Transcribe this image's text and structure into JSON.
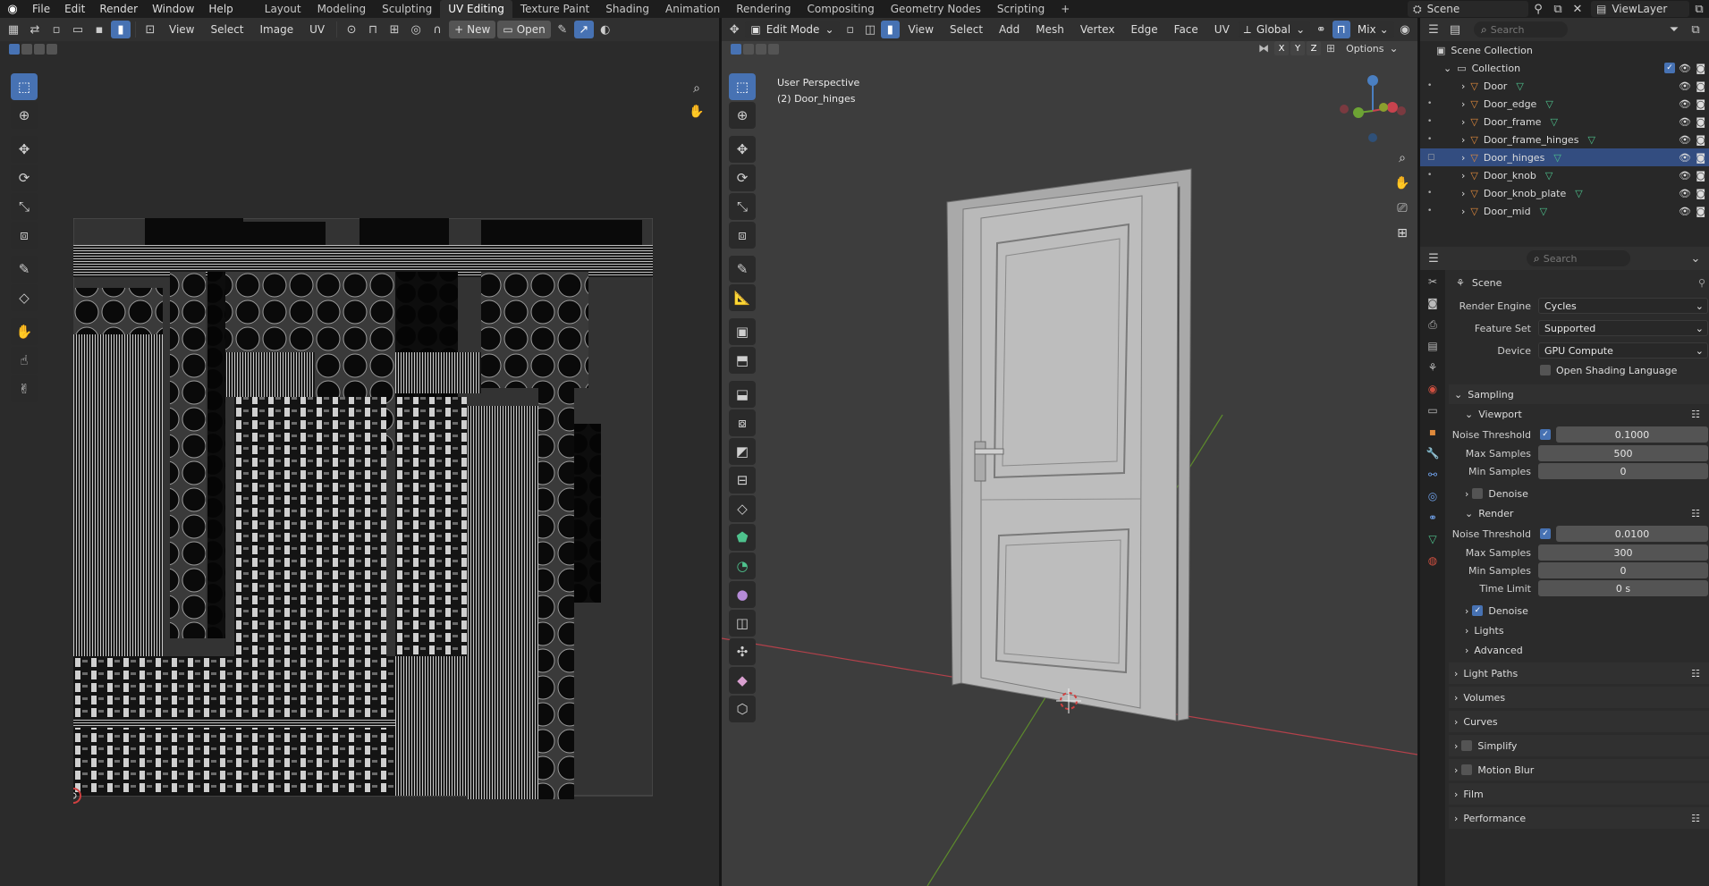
{
  "menu": {
    "items": [
      "File",
      "Edit",
      "Render",
      "Window",
      "Help"
    ],
    "workspaces": [
      "Layout",
      "Modeling",
      "Sculpting",
      "UV Editing",
      "Texture Paint",
      "Shading",
      "Animation",
      "Rendering",
      "Compositing",
      "Geometry Nodes",
      "Scripting"
    ],
    "active_workspace": "UV Editing",
    "add_tab": "+",
    "scene_name": "Scene",
    "view_layer": "ViewLayer"
  },
  "uv_editor": {
    "menus": [
      "View",
      "Select",
      "Image",
      "UV"
    ],
    "new_label": "New",
    "open_label": "Open"
  },
  "viewport": {
    "mode": "Edit Mode",
    "menus": [
      "View",
      "Select",
      "Add",
      "Mesh",
      "Vertex",
      "Edge",
      "Face",
      "UV"
    ],
    "orientation": "Global",
    "snap_label": "Mix",
    "options_label": "Options",
    "axes": [
      "X",
      "Y",
      "Z"
    ],
    "overlay_title": "User Perspective",
    "overlay_object": "(2) Door_hinges"
  },
  "outliner": {
    "search_placeholder": "Search",
    "scene_collection": "Scene Collection",
    "collection": "Collection",
    "objects": [
      "Door",
      "Door_edge",
      "Door_frame",
      "Door_frame_hinges",
      "Door_hinges",
      "Door_knob",
      "Door_knob_plate",
      "Door_mid"
    ],
    "selected": "Door_hinges"
  },
  "properties": {
    "search_placeholder": "Search",
    "context": "Scene",
    "render_engine_label": "Render Engine",
    "render_engine": "Cycles",
    "feature_set_label": "Feature Set",
    "feature_set": "Supported",
    "device_label": "Device",
    "device": "GPU Compute",
    "osl_label": "Open Shading Language",
    "sampling": "Sampling",
    "viewport": {
      "label": "Viewport",
      "noise_threshold_label": "Noise Threshold",
      "noise_threshold": "0.1000",
      "max_samples_label": "Max Samples",
      "max_samples": "500",
      "min_samples_label": "Min Samples",
      "min_samples": "0",
      "denoise_label": "Denoise"
    },
    "render": {
      "label": "Render",
      "noise_threshold_label": "Noise Threshold",
      "noise_threshold": "0.0100",
      "max_samples_label": "Max Samples",
      "max_samples": "300",
      "min_samples_label": "Min Samples",
      "min_samples": "0",
      "time_limit_label": "Time Limit",
      "time_limit": "0 s",
      "denoise_label": "Denoise"
    },
    "sub_panels": [
      "Lights",
      "Advanced"
    ],
    "panels": [
      "Light Paths",
      "Volumes",
      "Curves",
      "Simplify",
      "Motion Blur",
      "Film",
      "Performance"
    ]
  },
  "colors": {
    "accent": "#4772b3",
    "panel": "#303030",
    "viewport_bg": "#3d3d3d",
    "x_axis": "#c8434e",
    "y_axis": "#6da334",
    "object_orange": "#e08a3c",
    "mesh_green": "#4ec28d"
  }
}
